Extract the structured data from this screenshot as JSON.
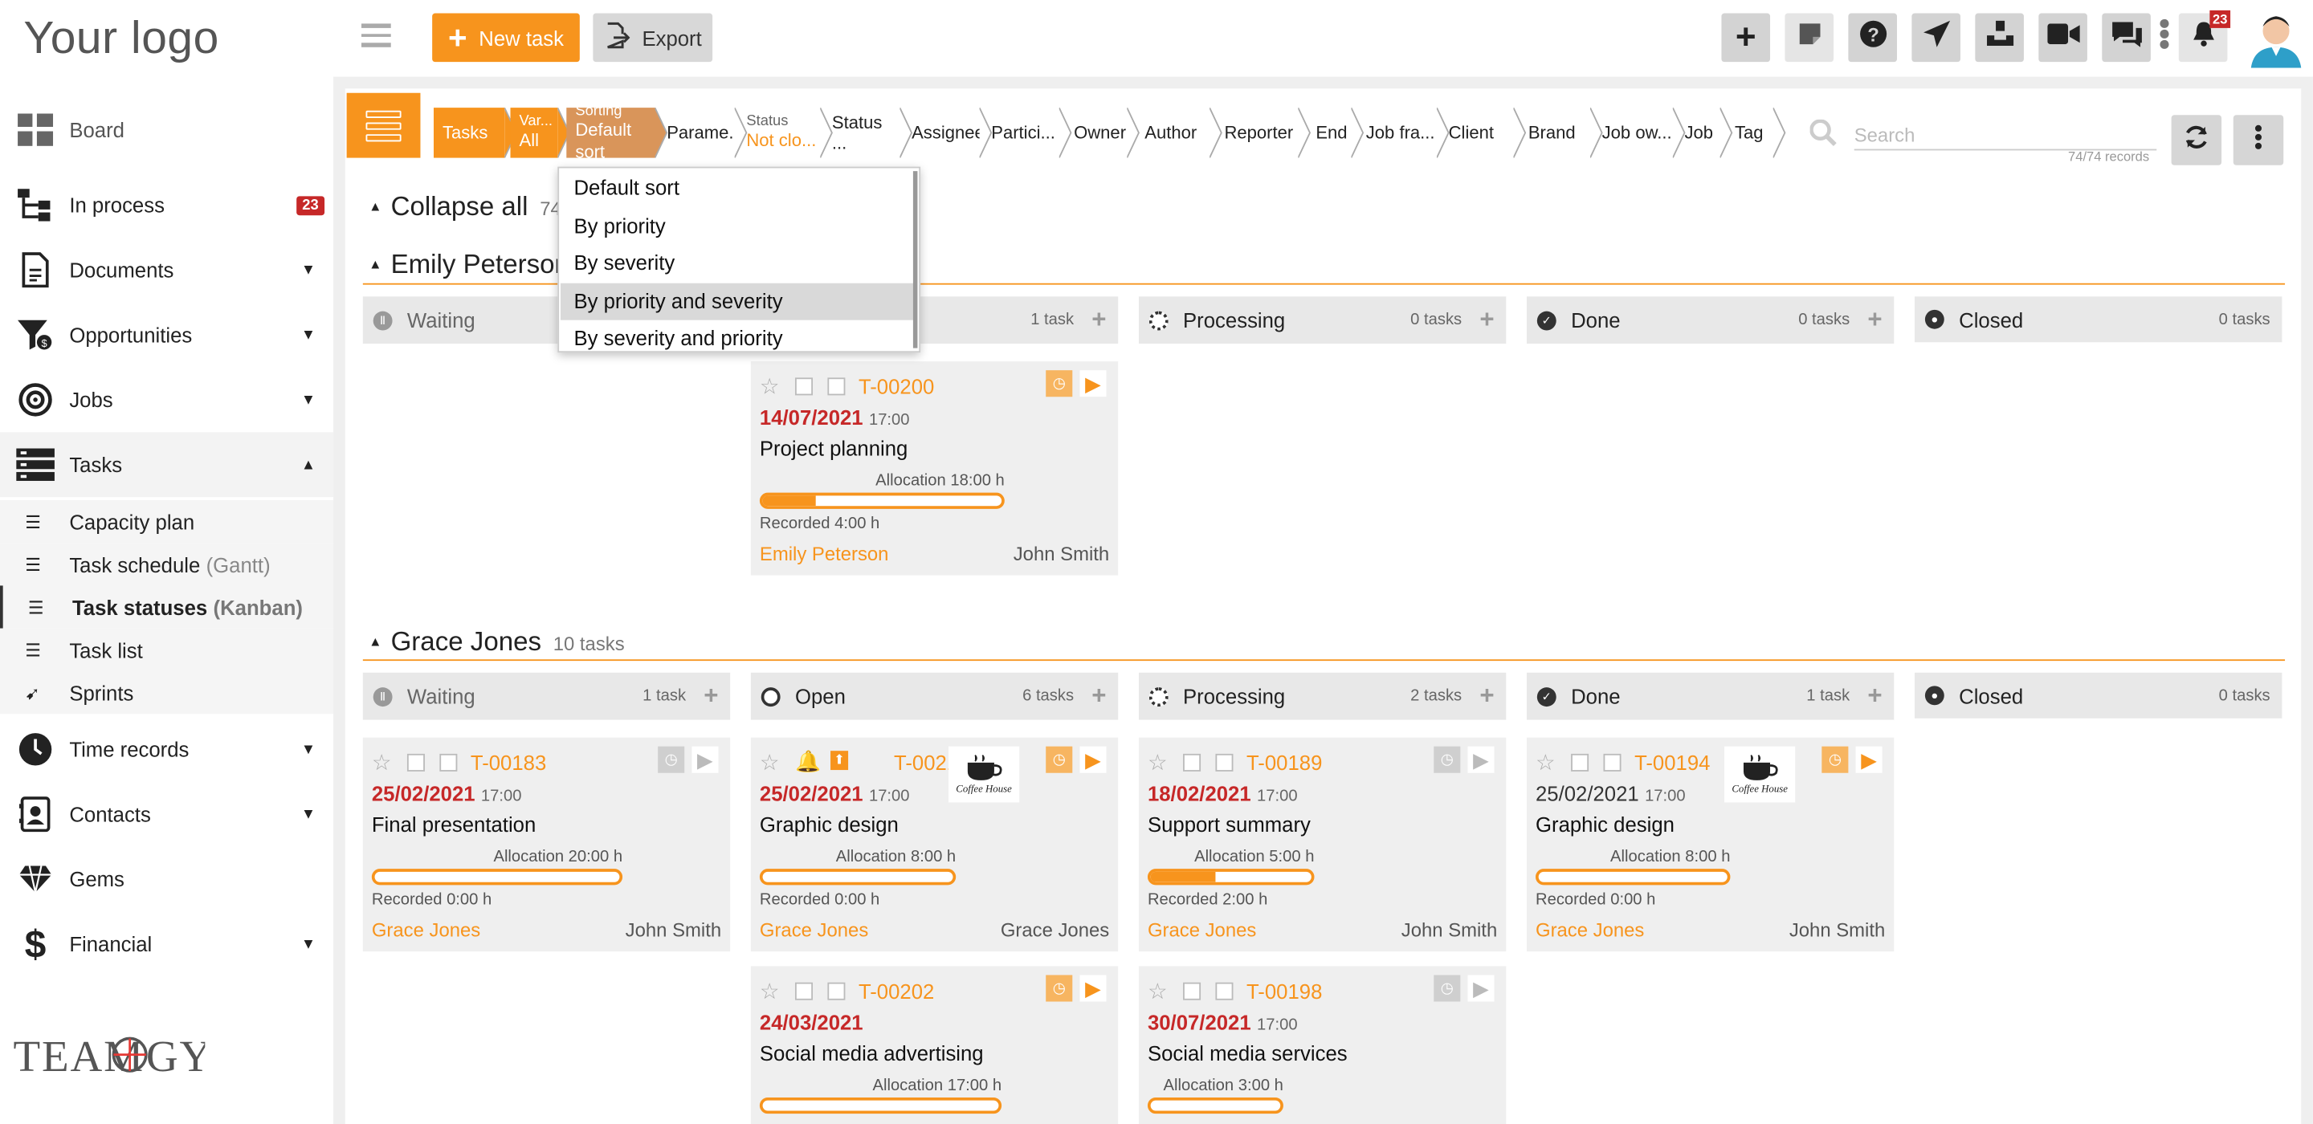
{
  "logo": "Your logo",
  "brand_logo": "TeamOgy",
  "sidebar": {
    "items": [
      {
        "label": "Board"
      },
      {
        "label": "In process",
        "badge": "23"
      },
      {
        "label": "Documents"
      },
      {
        "label": "Opportunities"
      },
      {
        "label": "Jobs"
      },
      {
        "label": "Tasks"
      },
      {
        "label": "Time records"
      },
      {
        "label": "Contacts"
      },
      {
        "label": "Gems"
      },
      {
        "label": "Financial"
      }
    ],
    "subitems": [
      {
        "label": "Capacity plan",
        "note": ""
      },
      {
        "label": "Task schedule",
        "note": "(Gantt)"
      },
      {
        "label": "Task statuses",
        "note": "(Kanban)"
      },
      {
        "label": "Task list",
        "note": ""
      },
      {
        "label": "Sprints",
        "note": ""
      }
    ]
  },
  "topbar": {
    "new_task": "New task",
    "export": "Export",
    "notif_count": "23"
  },
  "filters": {
    "crumbs": [
      {
        "small": "",
        "value": "Tasks"
      },
      {
        "small": "Var...",
        "value": "All"
      },
      {
        "small": "Sorting",
        "value": "Default sort"
      },
      {
        "small": "",
        "value": "Parame..."
      },
      {
        "small": "Status",
        "value": "Not clo..."
      },
      {
        "small": "",
        "value": "Status ..."
      },
      {
        "small": "",
        "value": "Assignee"
      },
      {
        "small": "",
        "value": "Partici..."
      },
      {
        "small": "",
        "value": "Owner"
      },
      {
        "small": "",
        "value": "Author"
      },
      {
        "small": "",
        "value": "Reporter"
      },
      {
        "small": "",
        "value": "End"
      },
      {
        "small": "",
        "value": "Job fra..."
      },
      {
        "small": "",
        "value": "Client"
      },
      {
        "small": "",
        "value": "Brand"
      },
      {
        "small": "",
        "value": "Job ow..."
      },
      {
        "small": "",
        "value": "Job"
      },
      {
        "small": "",
        "value": "Tag"
      }
    ],
    "search_placeholder": "Search",
    "records": "74/74 records"
  },
  "sort_dropdown": {
    "options": [
      "Default sort",
      "By priority",
      "By severity",
      "By priority and severity",
      "By severity and priority"
    ],
    "highlighted": "By priority and severity"
  },
  "board": {
    "collapse_all": "Collapse all",
    "collapse_count": "74",
    "groups": [
      {
        "name": "Emily Peterson",
        "count": "",
        "columns": [
          {
            "label": "Waiting",
            "count": ""
          },
          {
            "label": "Open",
            "count": "1 task"
          },
          {
            "label": "Processing",
            "count": "0 tasks"
          },
          {
            "label": "Done",
            "count": "0 tasks"
          },
          {
            "label": "Closed",
            "count": "0 tasks"
          }
        ],
        "cards": [
          {
            "id": "T-00200",
            "date": "14/07/2021",
            "time": "17:00",
            "title": "Project planning",
            "allocation": "Allocation 18:00 h",
            "recorded": "Recorded 4:00 h",
            "progress": 0.22,
            "owner": "Emily Peterson",
            "author": "John Smith"
          }
        ]
      },
      {
        "name": "Grace Jones",
        "count": "10 tasks",
        "columns": [
          {
            "label": "Waiting",
            "count": "1 task"
          },
          {
            "label": "Open",
            "count": "6 tasks"
          },
          {
            "label": "Processing",
            "count": "2 tasks"
          },
          {
            "label": "Done",
            "count": "1 task"
          },
          {
            "label": "Closed",
            "count": "0 tasks"
          }
        ],
        "cards": [
          {
            "id": "T-00183",
            "date": "25/02/2021",
            "time": "17:00",
            "title": "Final presentation",
            "allocation": "Allocation 20:00 h",
            "recorded": "Recorded 0:00 h",
            "progress": 0,
            "owner": "Grace Jones",
            "author": "John Smith"
          },
          {
            "id": "T-00210",
            "date": "25/02/2021",
            "time": "17:00",
            "title": "Graphic design",
            "allocation": "Allocation 8:00 h",
            "recorded": "Recorded 0:00 h",
            "progress": 0,
            "owner": "Grace Jones",
            "author": "Grace Jones",
            "thumb": "Coffee House"
          },
          {
            "id": "T-00189",
            "date": "18/02/2021",
            "time": "17:00",
            "title": "Support summary",
            "allocation": "Allocation 5:00 h",
            "recorded": "Recorded 2:00 h",
            "progress": 0.4,
            "owner": "Grace Jones",
            "author": "John Smith"
          },
          {
            "id": "T-00194",
            "date": "25/02/2021",
            "time": "17:00",
            "title": "Graphic design",
            "allocation": "Allocation 8:00 h",
            "recorded": "Recorded 0:00 h",
            "progress": 0,
            "owner": "Grace Jones",
            "author": "John Smith",
            "thumb": "Coffee House"
          },
          {
            "id": "T-00202",
            "date": "24/03/2021",
            "time": "",
            "title": "Social media advertising",
            "allocation": "Allocation 17:00 h",
            "recorded": "",
            "progress": 0
          },
          {
            "id": "T-00198",
            "date": "30/07/2021",
            "time": "17:00",
            "title": "Social media services",
            "allocation": "Allocation 3:00 h",
            "recorded": "",
            "progress": 0
          }
        ]
      }
    ]
  },
  "colors": {
    "accent": "#f7941d",
    "danger": "#c62828"
  }
}
